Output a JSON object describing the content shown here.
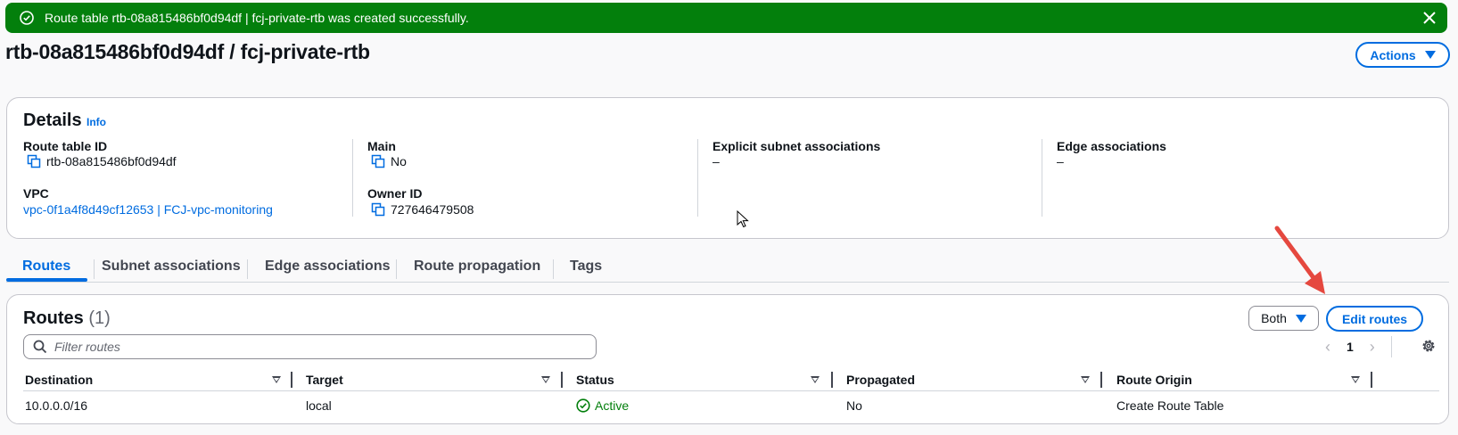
{
  "flash": {
    "message": "Route table rtb-08a815486bf0d94df | fcj-private-rtb was created successfully.",
    "icon": "check-circle-icon",
    "close_icon": "close-icon",
    "color": "#037f0c"
  },
  "page": {
    "title": "rtb-08a815486bf0d94df / fcj-private-rtb",
    "actions_label": "Actions"
  },
  "details": {
    "heading": "Details",
    "info_label": "Info",
    "route_table_id_label": "Route table ID",
    "route_table_id": "rtb-08a815486bf0d94df",
    "vpc_label": "VPC",
    "vpc_value": "vpc-0f1a4f8d49cf12653 | FCJ-vpc-monitoring",
    "main_label": "Main",
    "main_value": "No",
    "owner_label": "Owner ID",
    "owner_value": "727646479508",
    "explicit_label": "Explicit subnet associations",
    "explicit_value": "–",
    "edge_label": "Edge associations",
    "edge_value": "–"
  },
  "tabs": [
    {
      "label": "Routes",
      "active": true
    },
    {
      "label": "Subnet associations",
      "active": false
    },
    {
      "label": "Edge associations",
      "active": false
    },
    {
      "label": "Route propagation",
      "active": false
    },
    {
      "label": "Tags",
      "active": false
    }
  ],
  "routes": {
    "heading": "Routes",
    "count": "(1)",
    "filter_select": "Both",
    "edit_label": "Edit routes",
    "filter_placeholder": "Filter routes",
    "page_number": "1",
    "columns": [
      "Destination",
      "Target",
      "Status",
      "Propagated",
      "Route Origin"
    ],
    "rows": [
      {
        "destination": "10.0.0.0/16",
        "target": "local",
        "status": "Active",
        "propagated": "No",
        "origin": "Create Route Table"
      }
    ]
  },
  "colors": {
    "accent": "#006ce0",
    "success": "#037f0c",
    "annotation_arrow": "#e5483f"
  }
}
